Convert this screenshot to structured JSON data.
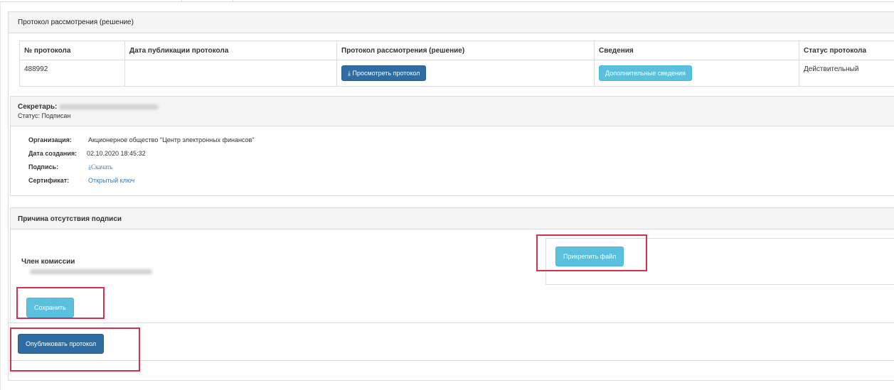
{
  "main_panel": {
    "title": "Протокол рассмотрения (решение)"
  },
  "protocol_table": {
    "columns": [
      "№ протокола",
      "Дата публикации протокола",
      "Протокол рассмотрения (решение)",
      "Сведения",
      "Статус протокола"
    ],
    "row": {
      "number": "488992",
      "publish_date": "",
      "view_button": "Просмотреть протокол",
      "details_button": "Дополнительные сведения",
      "status": "Действительный"
    }
  },
  "secretary": {
    "label": "Секретарь:",
    "status": "Статус: Подписан",
    "org_label": "Организация:",
    "org_value": "Акционерное общество \"Центр электронных финансов\"",
    "created_label": "Дата создания:",
    "created_value": "02.10.2020 18:45:32",
    "signature_label": "Подпись:",
    "signature_link": "Скачать",
    "cert_label": "Сертификат:",
    "cert_link": "Открытый ключ"
  },
  "missing_signature": {
    "title": "Причина отсутствия подписи",
    "member_label": "Член комиссии",
    "attach_button": "Прикрепить файл",
    "save_button": "Сохранить"
  },
  "publish_button": "Опубликовать протокол",
  "colors": {
    "primary": "#2e6da4",
    "info": "#5bc0de",
    "status_ok": "#3c8a2e",
    "highlight": "#d2324c"
  }
}
